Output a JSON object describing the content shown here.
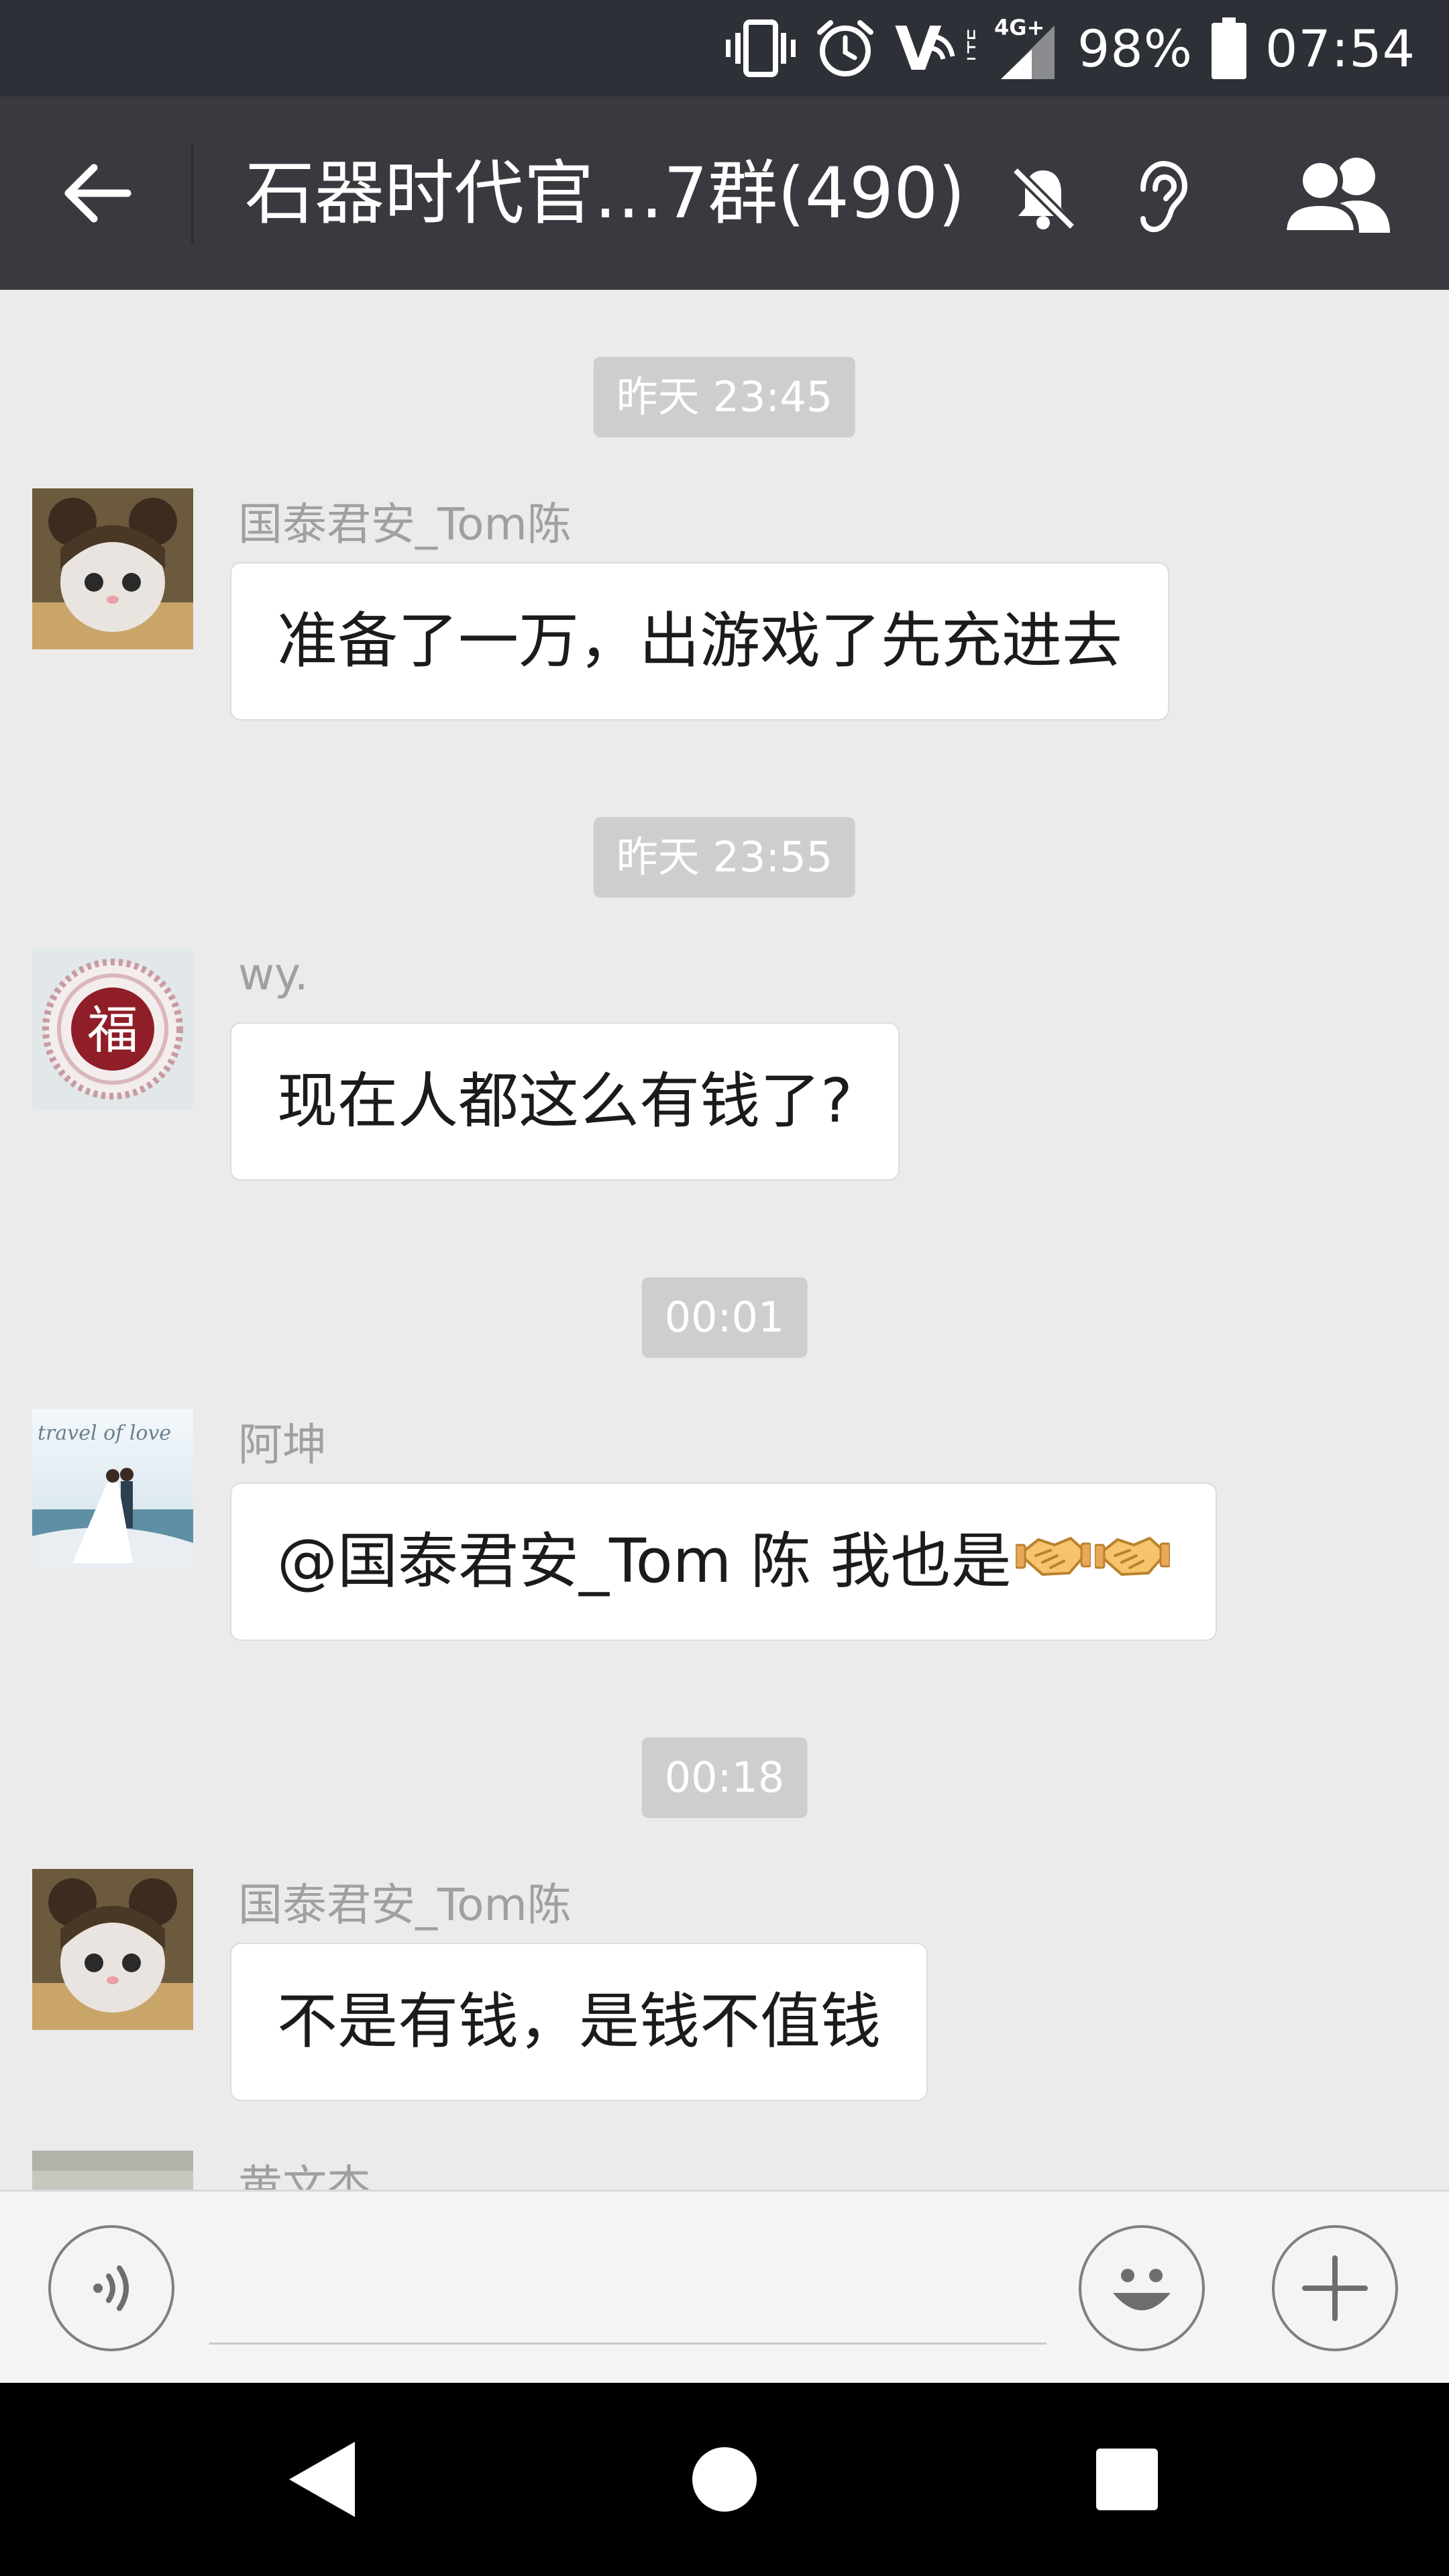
{
  "status_bar": {
    "battery": "98%",
    "time": "07:54",
    "network": "4G+",
    "carrier_badge": "V",
    "lte": "LTE"
  },
  "header": {
    "title": "石器时代官…7群(490)"
  },
  "messages": [
    {
      "time": "昨天 23:45",
      "sender": "国泰君安_Tom陈",
      "text": "准备了一万，出游戏了先充进去"
    },
    {
      "time": "昨天 23:55",
      "sender": "wy.",
      "text": "现在人都这么有钱了?"
    },
    {
      "time": "00:01",
      "sender": "阿坤",
      "text": "@国泰君安_Tom 陈  我也是"
    },
    {
      "time": "00:18",
      "sender": "国泰君安_Tom陈",
      "text": "不是有钱，是钱不值钱"
    },
    {
      "sender": "黄文杰"
    }
  ],
  "avatars": {
    "fu_char": "福",
    "wedding_caption": "travel of love"
  },
  "input": {
    "placeholder": ""
  },
  "colors": {
    "status_bar": "#2d3036",
    "title_bar": "#393a3f",
    "chat_bg": "#ebebeb",
    "bubble": "#ffffff",
    "time_pill": "#cecece",
    "input_bar": "#f4f4f6",
    "nav_bar": "#000000"
  },
  "icons": {
    "status": [
      "vibrate-icon",
      "alarm-icon",
      "volte-icon",
      "signal-icon",
      "battery-icon"
    ],
    "header": [
      "back-arrow-icon",
      "mute-bell-icon",
      "ear-icon",
      "group-members-icon"
    ],
    "input": [
      "voice-icon",
      "emoji-face-icon",
      "plus-icon"
    ],
    "nav": [
      "nav-back-icon",
      "nav-home-icon",
      "nav-recents-icon"
    ]
  }
}
